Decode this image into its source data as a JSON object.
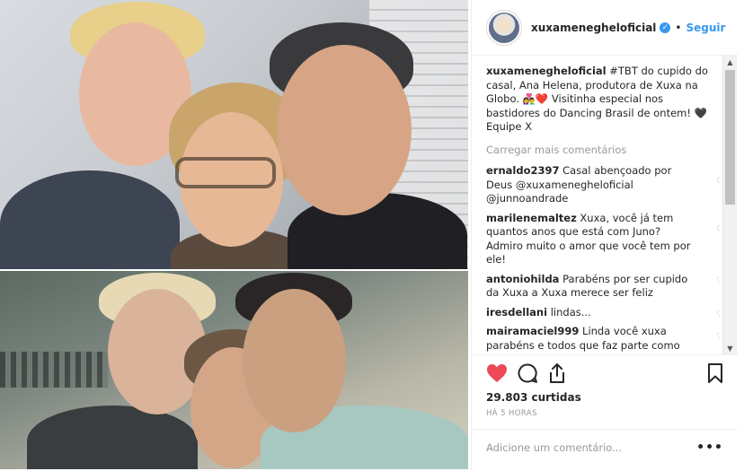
{
  "header": {
    "username": "xuxameneghel oficial",
    "username_exact": "xuxamenegheloficial",
    "separator": "•",
    "follow_label": "Seguir"
  },
  "caption": {
    "username": "xuxamenegheloficial",
    "text": "#TBT do cupido do casal, Ana Helena, produtora de Xuxa na Globo. 👩‍❤️‍👨❤️ Visitinha especial nos bastidores do Dancing Brasil de ontem! 🖤 Equipe X"
  },
  "load_more_label": "Carregar mais comentários",
  "comments": [
    {
      "username": "ernaldo2397",
      "text": "Casal abençoado por Deus @xuxamenegheloficial @junnoandrade"
    },
    {
      "username": "marilenemaltez",
      "text": "Xuxa, você já tem quantos anos que está com Juno? Admiro muito o amor que você tem por ele!"
    },
    {
      "username": "antoniohilda",
      "text": "Parabéns por ser cupido da Xuxa a Xuxa merece ser feliz"
    },
    {
      "username": "iresdellani",
      "text": "lindas..."
    },
    {
      "username": "mairamaciel999",
      "text": "Linda você xuxa parabéns e todos que faz parte como"
    }
  ],
  "likes_text": "29.803 curtidas",
  "time_text": "HÁ 5 HORAS",
  "add_comment_placeholder": "Adicione um comentário...",
  "more_label": "•••",
  "icons": {
    "like": "heart-filled-icon",
    "comment": "comment-bubble-icon",
    "share": "share-upload-icon",
    "save": "bookmark-icon",
    "verified": "verified-badge-icon"
  },
  "colors": {
    "like": "#ed4956",
    "accent": "#3897f0",
    "muted": "#999999"
  }
}
